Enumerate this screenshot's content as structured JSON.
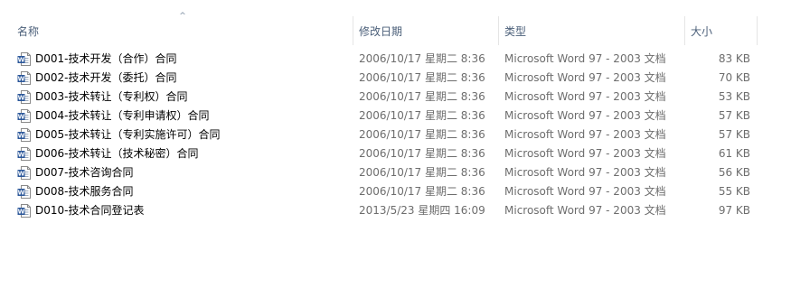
{
  "columns": {
    "name": "名称",
    "date": "修改日期",
    "type": "类型",
    "size": "大小",
    "sort_indicator": "^"
  },
  "files": [
    {
      "icon": "word-document-icon",
      "name": "D001-技术开发（合作）合同",
      "date": "2006/10/17 星期二 8:36",
      "type": "Microsoft Word 97 - 2003 文档",
      "size": "83 KB"
    },
    {
      "icon": "word-document-icon",
      "name": "D002-技术开发（委托）合同",
      "date": "2006/10/17 星期二 8:36",
      "type": "Microsoft Word 97 - 2003 文档",
      "size": "70 KB"
    },
    {
      "icon": "word-document-icon",
      "name": "D003-技术转让（专利权）合同",
      "date": "2006/10/17 星期二 8:36",
      "type": "Microsoft Word 97 - 2003 文档",
      "size": "53 KB"
    },
    {
      "icon": "word-document-icon",
      "name": "D004-技术转让（专利申请权）合同",
      "date": "2006/10/17 星期二 8:36",
      "type": "Microsoft Word 97 - 2003 文档",
      "size": "57 KB"
    },
    {
      "icon": "word-document-icon",
      "name": "D005-技术转让（专利实施许可）合同",
      "date": "2006/10/17 星期二 8:36",
      "type": "Microsoft Word 97 - 2003 文档",
      "size": "57 KB"
    },
    {
      "icon": "word-document-icon",
      "name": "D006-技术转让（技术秘密）合同",
      "date": "2006/10/17 星期二 8:36",
      "type": "Microsoft Word 97 - 2003 文档",
      "size": "61 KB"
    },
    {
      "icon": "word-document-icon",
      "name": "D007-技术咨询合同",
      "date": "2006/10/17 星期二 8:36",
      "type": "Microsoft Word 97 - 2003 文档",
      "size": "56 KB"
    },
    {
      "icon": "word-document-icon",
      "name": "D008-技术服务合同",
      "date": "2006/10/17 星期二 8:36",
      "type": "Microsoft Word 97 - 2003 文档",
      "size": "55 KB"
    },
    {
      "icon": "word-document-icon",
      "name": "D010-技术合同登记表",
      "date": "2013/5/23 星期四 16:09",
      "type": "Microsoft Word 97 - 2003 文档",
      "size": "97 KB"
    }
  ],
  "colors": {
    "header_text": "#4c607a",
    "detail_text": "#6d6d6d",
    "word_icon_blue": "#2b579a"
  }
}
